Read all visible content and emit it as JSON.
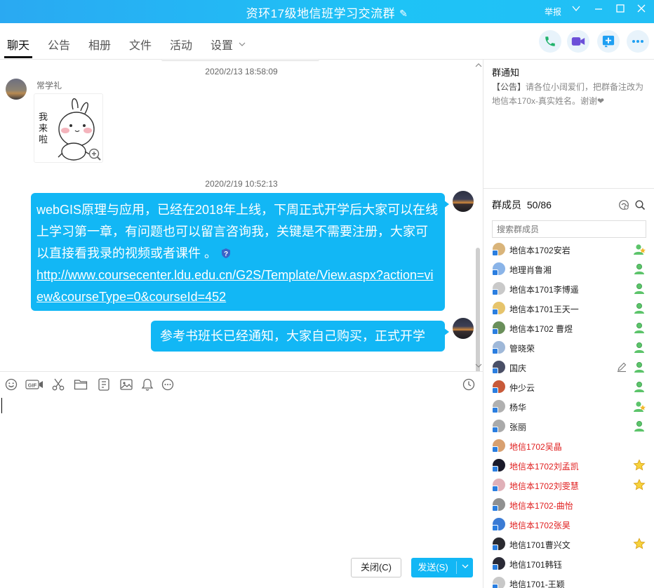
{
  "window": {
    "title": "资环17级地信班学习交流群",
    "report_label": "举报"
  },
  "tabs": [
    {
      "label": "聊天"
    },
    {
      "label": "公告"
    },
    {
      "label": "相册"
    },
    {
      "label": "文件"
    },
    {
      "label": "活动"
    },
    {
      "label": "设置"
    }
  ],
  "toolbar_icons": [
    "phone-icon",
    "video-icon",
    "share-screen-icon",
    "more-icon"
  ],
  "chat": {
    "messages": [
      {
        "timestamp": "2020/2/13 18:58:09",
        "sender": "常学礼",
        "type": "sticker",
        "sticker_text": "我来啦"
      },
      {
        "timestamp": "2020/2/19 10:52:13",
        "type": "text",
        "text": "webGIS原理与应用，已经在2018年上线，下周正式开学后大家可以在线上学习第一章，有问题也可以留言咨询我，关键是不需要注册，大家可以直接看我录的视频或者课件 。",
        "link": "http://www.coursecenter.ldu.edu.cn/G2S/Template/View.aspx?action=view&courseType=0&courseId=452"
      },
      {
        "type": "text",
        "text": "参考书班长已经通知，大家自己购买，正式开学用"
      }
    ]
  },
  "input": {
    "close_label": "关闭(C)",
    "send_label": "发送(S)"
  },
  "notice": {
    "title": "群通知",
    "tag": "【公告】",
    "text": "请各位小阔爱们，把群备注改为地信本170x-真实姓名。谢谢❤"
  },
  "members": {
    "title": "群成员",
    "count": "50/86",
    "search_placeholder": "搜索群成员",
    "list": [
      {
        "name": "地信本1702安岩",
        "role": "admin",
        "red": false,
        "avatar": "#d9b47a"
      },
      {
        "name": "地理肖鲁湘",
        "role": "member",
        "red": false,
        "avatar": "#8ab4e8"
      },
      {
        "name": "地信本1701李博遥",
        "role": "member",
        "red": false,
        "avatar": "#c9c9c9"
      },
      {
        "name": "地信本1701王天一",
        "role": "member",
        "red": false,
        "avatar": "#e6c46c"
      },
      {
        "name": "地信本1702 曹煜",
        "role": "member",
        "red": false,
        "avatar": "#6a8f5a"
      },
      {
        "name": "管晓荣",
        "role": "member",
        "red": false,
        "avatar": "#9fb8d8"
      },
      {
        "name": "国庆",
        "role": "member",
        "red": false,
        "avatar": "#4a4f66"
      },
      {
        "name": "仲少云",
        "role": "member",
        "red": false,
        "avatar": "#c85a3a"
      },
      {
        "name": "杨华",
        "role": "admin",
        "red": false,
        "avatar": "#b0b0b0"
      },
      {
        "name": "张丽",
        "role": "member",
        "red": false,
        "avatar": "#aaaaaa"
      },
      {
        "name": "地信1702吴晶",
        "role": "",
        "red": true,
        "avatar": "#d8a070"
      },
      {
        "name": "地信本1702刘孟凯",
        "role": "star",
        "red": true,
        "avatar": "#1a1a2a"
      },
      {
        "name": "地信本1702刘雯慧",
        "role": "star",
        "red": true,
        "avatar": "#e0b0b8"
      },
      {
        "name": "地信本1702-曲怡",
        "role": "",
        "red": true,
        "avatar": "#909090"
      },
      {
        "name": "地信本1702张昊",
        "role": "",
        "red": true,
        "avatar": "#3b7bd4"
      },
      {
        "name": "地信1701曹兴文",
        "role": "star",
        "red": false,
        "avatar": "#2a2a30"
      },
      {
        "name": "地信1701韩钰",
        "role": "",
        "red": false,
        "avatar": "#2a2a36"
      },
      {
        "name": "地信1701-王颖",
        "role": "",
        "red": false,
        "avatar": "#c8c8c8"
      }
    ]
  },
  "colors": {
    "titlebar": "#1ec3f6",
    "bubble": "#12b7f5",
    "admin_red": "#e02020"
  }
}
